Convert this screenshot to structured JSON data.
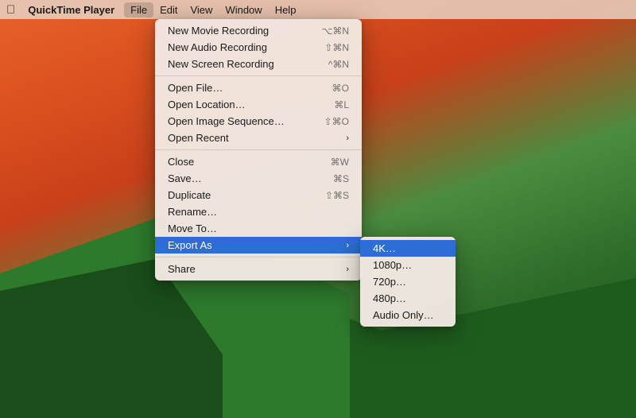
{
  "menubar": {
    "apple": "🍎",
    "app_name": "QuickTime Player",
    "items": [
      "File",
      "Edit",
      "View",
      "Window",
      "Help"
    ]
  },
  "file_menu": {
    "active_item": "File",
    "sections": [
      {
        "items": [
          {
            "label": "New Movie Recording",
            "shortcut": "⌥⌘N",
            "has_submenu": false
          },
          {
            "label": "New Audio Recording",
            "shortcut": "⇧⌘N",
            "has_submenu": false
          },
          {
            "label": "New Screen Recording",
            "shortcut": "^⌘N",
            "has_submenu": false
          }
        ]
      },
      {
        "items": [
          {
            "label": "Open File…",
            "shortcut": "⌘O",
            "has_submenu": false
          },
          {
            "label": "Open Location…",
            "shortcut": "⌘L",
            "has_submenu": false
          },
          {
            "label": "Open Image Sequence…",
            "shortcut": "⇧⌘O",
            "has_submenu": false
          },
          {
            "label": "Open Recent",
            "shortcut": "",
            "has_submenu": true,
            "arrow": "›"
          }
        ]
      },
      {
        "items": [
          {
            "label": "Close",
            "shortcut": "⌘W",
            "has_submenu": false
          },
          {
            "label": "Save…",
            "shortcut": "⌘S",
            "has_submenu": false
          },
          {
            "label": "Duplicate",
            "shortcut": "⇧⌘S",
            "has_submenu": false
          },
          {
            "label": "Rename…",
            "shortcut": "",
            "has_submenu": false
          },
          {
            "label": "Move To…",
            "shortcut": "",
            "has_submenu": false
          },
          {
            "label": "Export As",
            "shortcut": "",
            "has_submenu": true,
            "arrow": "›",
            "active": true
          }
        ]
      },
      {
        "items": [
          {
            "label": "Share",
            "shortcut": "",
            "has_submenu": true,
            "arrow": "›"
          }
        ]
      }
    ]
  },
  "export_submenu": {
    "items": [
      {
        "label": "4K…",
        "highlighted": true
      },
      {
        "label": "1080p…",
        "highlighted": false
      },
      {
        "label": "720p…",
        "highlighted": false
      },
      {
        "label": "480p…",
        "highlighted": false
      },
      {
        "label": "Audio Only…",
        "highlighted": false
      }
    ]
  }
}
